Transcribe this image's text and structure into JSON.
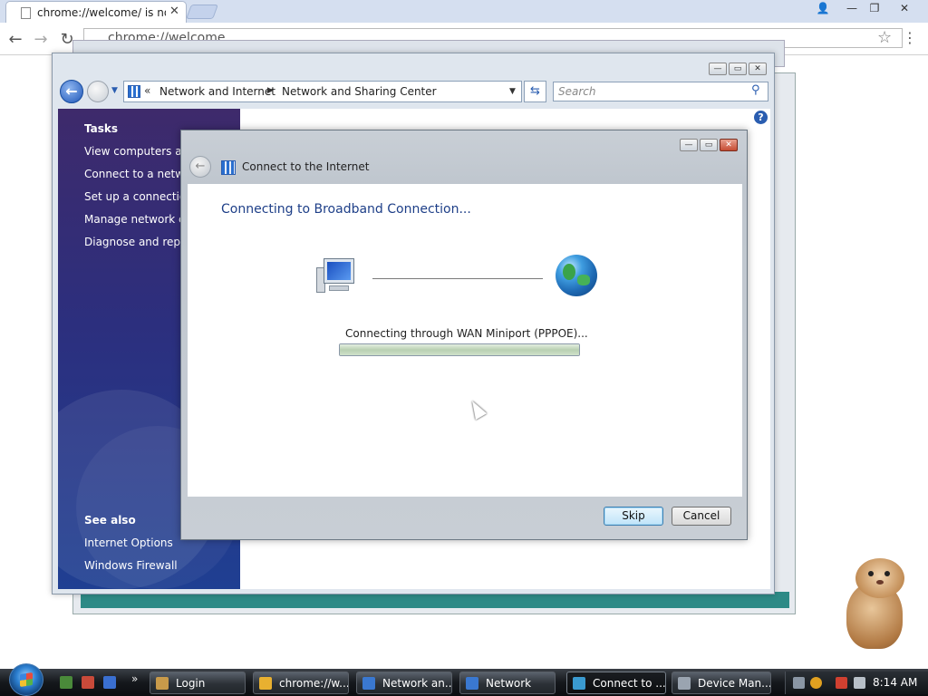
{
  "browser": {
    "tab_title": "chrome://welcome/ is not",
    "tab_close": "✕",
    "address": "chrome://welcome",
    "back_glyph": "←",
    "forward_glyph": "→",
    "reload_glyph": "↻",
    "star_glyph": "☆",
    "menu_glyph": "⋮",
    "window_controls": {
      "user": "👤",
      "minimize": "—",
      "restore": "❐",
      "close": "✕"
    }
  },
  "nsc_window": {
    "breadcrumb_chevron": "«",
    "breadcrumb": [
      "Network and Internet",
      "Network and Sharing Center"
    ],
    "search_placeholder": "Search",
    "help_glyph": "?",
    "controls": {
      "minimize": "—",
      "maximize": "▭",
      "close": "✕"
    },
    "sidebar": {
      "tasks_heading": "Tasks",
      "tasks": [
        "View computers and",
        "Connect to a networ",
        "Set up a connection",
        "Manage network co",
        "Diagnose and repair"
      ],
      "see_also_heading": "See also",
      "see_also": [
        "Internet Options",
        "Windows Firewall"
      ]
    }
  },
  "dialog": {
    "title": "Connect to the Internet",
    "heading": "Connecting to Broadband Connection...",
    "status": "Connecting through WAN Miniport (PPPOE)...",
    "progress": 1.0,
    "buttons": {
      "skip": "Skip",
      "cancel": "Cancel"
    },
    "controls": {
      "minimize": "—",
      "maximize": "▭",
      "close": "✕"
    },
    "icons": {
      "left": "computer-icon",
      "right": "globe-icon"
    }
  },
  "taskbar": {
    "more_glyph": "»",
    "tasks": [
      {
        "label": "Login",
        "color": "#c89a4a"
      },
      {
        "label": "chrome://w...",
        "color": "#e8b030"
      },
      {
        "label": "Network an...",
        "color": "#3a78d0"
      },
      {
        "label": "Network",
        "color": "#3a78d0"
      },
      {
        "label": "Connect to ...",
        "color": "#3a9ad0"
      },
      {
        "label": "Device Man...",
        "color": "#9aa4b0"
      }
    ],
    "active_index": 4,
    "clock": "8:14 AM"
  },
  "colors": {
    "sidebar_top": "#3e2a6b",
    "sidebar_bottom": "#1f3f92",
    "dialog_heading": "#1e3f88",
    "taskbar": "#15181c"
  }
}
